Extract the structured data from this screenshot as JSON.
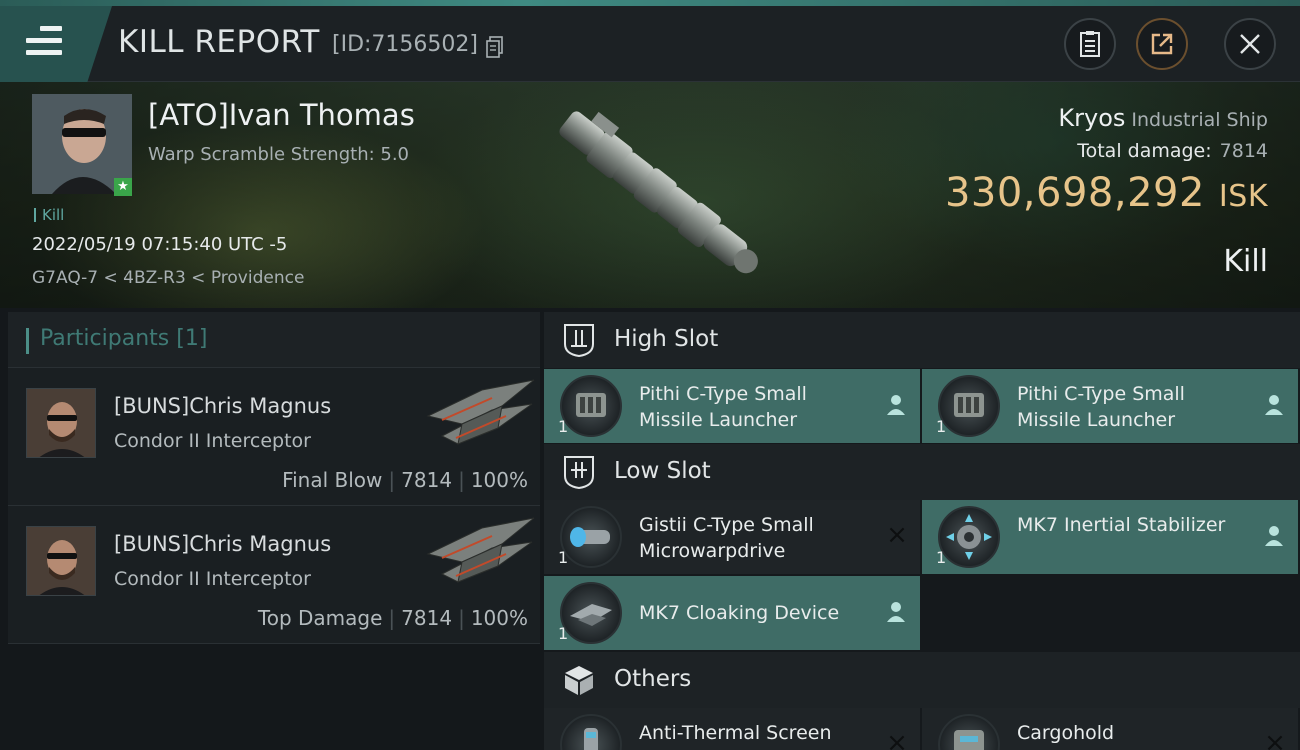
{
  "header": {
    "title": "KILL REPORT",
    "report_id": "[ID:7156502]"
  },
  "victim": {
    "name": "[ATO]Ivan Thomas",
    "warp_scramble": "Warp Scramble Strength: 5.0",
    "tag": "Kill",
    "date": "2022/05/19 07:15:40 UTC -5",
    "location": "G7AQ-7 < 4BZ-R3 < Providence",
    "ship_name": "Kryos",
    "ship_class": "Industrial Ship",
    "total_damage_label": "Total damage:",
    "total_damage": "7814",
    "isk_value": "330,698,292",
    "isk_unit": "ISK",
    "result": "Kill"
  },
  "participants": {
    "label": "Participants",
    "count": "[1]",
    "rows": [
      {
        "name": "[BUNS]Chris Magnus",
        "ship": "Condor II Interceptor",
        "role": "Final Blow",
        "damage": "7814",
        "percent": "100%"
      },
      {
        "name": "[BUNS]Chris Magnus",
        "ship": "Condor II Interceptor",
        "role": "Top Damage",
        "damage": "7814",
        "percent": "100%"
      }
    ]
  },
  "slots": {
    "high": {
      "label": "High Slot",
      "items": [
        {
          "name": "Pithi C-Type Small Missile Launcher",
          "qty": "1",
          "status": "fitted"
        },
        {
          "name": "Pithi C-Type Small Missile Launcher",
          "qty": "1",
          "status": "fitted"
        }
      ]
    },
    "low": {
      "label": "Low Slot",
      "items": [
        {
          "name": "Gistii C-Type Small Microwarpdrive",
          "qty": "1",
          "status": "destroyed"
        },
        {
          "name": "MK7 Inertial Stabilizer",
          "qty": "1",
          "status": "fitted"
        },
        {
          "name": "MK7 Cloaking Device",
          "qty": "1",
          "status": "fitted"
        }
      ]
    },
    "others": {
      "label": "Others",
      "items": [
        {
          "name": "Anti-Thermal Screen",
          "status": "destroyed"
        },
        {
          "name": "Cargohold",
          "status": "destroyed"
        }
      ]
    }
  },
  "colors": {
    "accent_teal": "#3f6c66",
    "isk_gold": "#e7c48a",
    "badge_green": "#3aa54a"
  }
}
